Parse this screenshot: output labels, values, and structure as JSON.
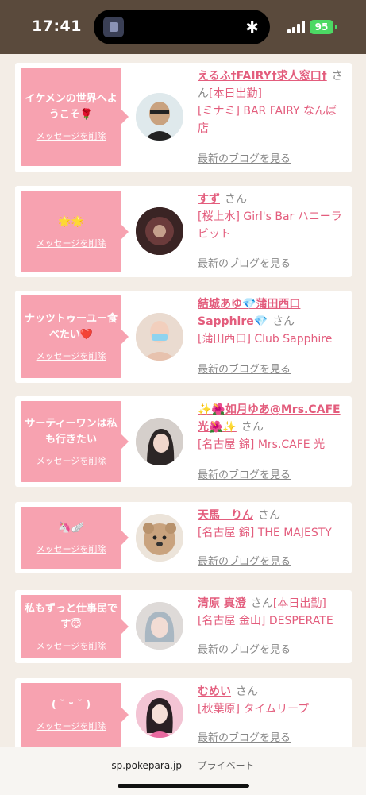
{
  "status": {
    "time": "17:41",
    "battery": "95"
  },
  "delete_label": "メッセージを削除",
  "blog_label": "最新のブログを見る",
  "honorific": "さん",
  "cards": [
    {
      "message": "イケメンの世界へようこそ🌹",
      "name": "えるふ†FAIRY†求人窓口†",
      "extra": "[本日出勤]",
      "shop": "[ミナミ] BAR FAIRY なんば店"
    },
    {
      "message": "🌟🌟",
      "name": "すず",
      "extra": "",
      "shop": "[桜上水] Girl's Bar ハニーラビット"
    },
    {
      "message": "ナッツトゥーユー食べたい❤️",
      "name": "結城あゆ💎蒲田西口Sapphire💎",
      "extra": "",
      "shop": "[蒲田西口] Club Sapphire"
    },
    {
      "message": "サーティーワンは私も行きたい",
      "name": "✨🌺如月ゆあ@Mrs.CAFE光🌺✨",
      "extra": "",
      "shop": "[名古屋 錦] Mrs.CAFE 光"
    },
    {
      "message": "🦄🪽",
      "name": "天馬　りん",
      "extra": "",
      "shop": "[名古屋 錦] THE MAJESTY"
    },
    {
      "message": "私もずっと仕事民です😇",
      "name": "清原 真澄",
      "extra": "[本日出勤]",
      "shop": "[名古屋 金山] DESPERATE"
    },
    {
      "message": "( ˘ ᵕ ˘ )",
      "name": "むめい",
      "extra": "",
      "shop": "[秋葉原] タイムリープ"
    }
  ],
  "browser": {
    "url": "sp.pokepara.jp",
    "privacy": "— プライベート"
  },
  "colors": {
    "accent": "#e35d7d",
    "bubble": "#f7a2b0",
    "statusbar": "#5a4a3c"
  }
}
